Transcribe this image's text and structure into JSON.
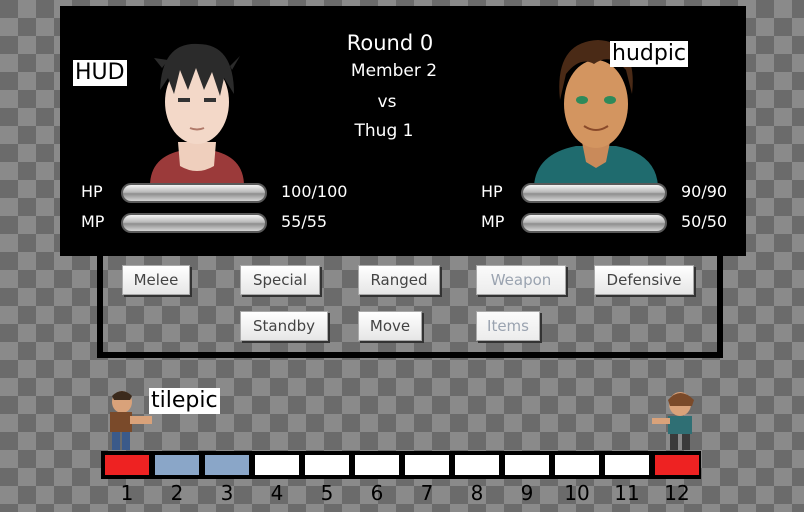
{
  "labels": {
    "hud": "HUD",
    "hudpic": "hudpic",
    "tilepic": "tilepic"
  },
  "header": {
    "round": "Round 0",
    "player": "Member 2",
    "vs": "vs",
    "enemy": "Thug 1"
  },
  "left_stats": {
    "hp_label": "HP",
    "mp_label": "MP",
    "hp_value": "100/100",
    "mp_value": "55/55"
  },
  "right_stats": {
    "hp_label": "HP",
    "mp_label": "MP",
    "hp_value": "90/90",
    "mp_value": "50/50"
  },
  "actions": {
    "melee": "Melee",
    "special": "Special",
    "ranged": "Ranged",
    "weapon": "Weapon",
    "defensive": "Defensive",
    "standby": "Standby",
    "move": "Move",
    "items": "Items"
  },
  "tiles": [
    "1",
    "2",
    "3",
    "4",
    "5",
    "6",
    "7",
    "8",
    "9",
    "10",
    "11",
    "12"
  ],
  "tile_colors": [
    "#ee2222",
    "#8aa6c8",
    "#8aa6c8",
    "#ffffff",
    "#ffffff",
    "#ffffff",
    "#ffffff",
    "#ffffff",
    "#ffffff",
    "#ffffff",
    "#ffffff",
    "#ee2222"
  ]
}
